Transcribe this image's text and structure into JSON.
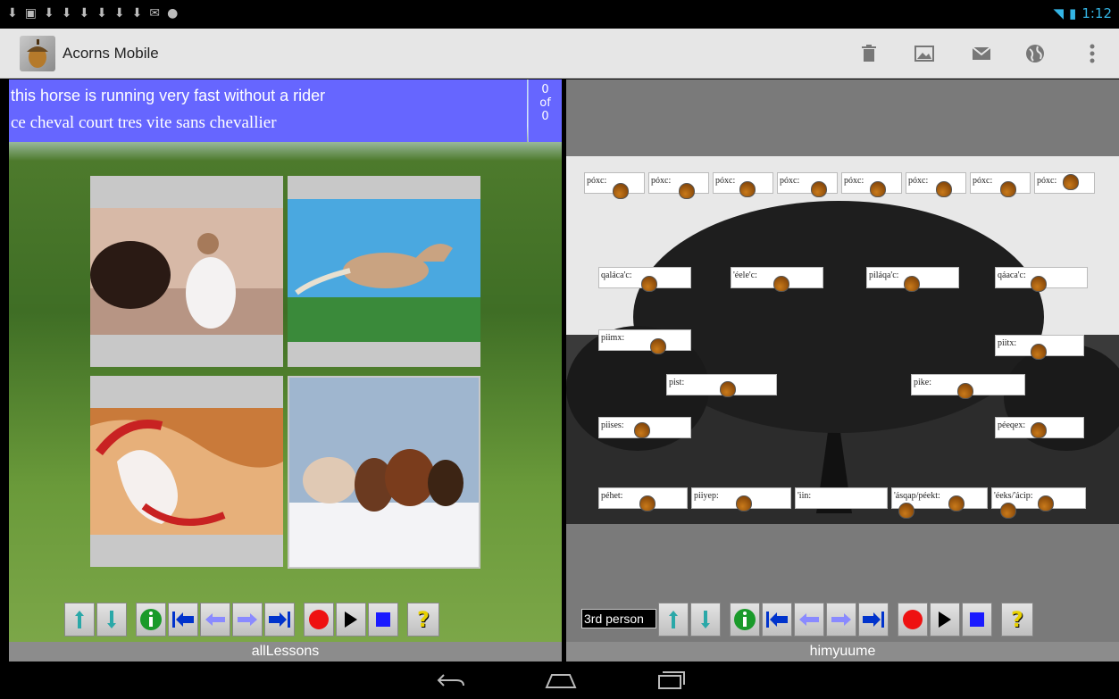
{
  "status_bar": {
    "time": "1:12",
    "notification_icons": [
      "download-icon",
      "image-icon",
      "download-icon",
      "download-icon",
      "download-icon",
      "download-icon",
      "download-icon",
      "download-icon",
      "gmail-icon",
      "android-icon"
    ],
    "wifi_icon": "wifi-icon",
    "battery_icon": "battery-icon"
  },
  "action_bar": {
    "title": "Acorns Mobile",
    "actions": [
      "trash-icon",
      "image-icon",
      "mail-icon",
      "globe-icon",
      "overflow-menu-icon"
    ]
  },
  "left_pane": {
    "phrase_line1": "this horse is running very fast without a rider",
    "phrase_line2": "ce cheval court tres vite sans chevallier",
    "counter_current": "0",
    "counter_of": "of",
    "counter_total": "0",
    "images": [
      "woman-with-horse-picture",
      "running-horse-picture",
      "painted-horse-picture",
      "horse-herd-picture"
    ],
    "label": "allLessons"
  },
  "right_pane": {
    "label": "himyuume",
    "relation_field": "3rd person",
    "top_row": [
      "póxc:",
      "póxc:",
      "póxc:",
      "póxc:",
      "póxc:",
      "póxc:",
      "póxc:",
      "póxc:"
    ],
    "second_row": [
      "qaláca'c:",
      "'éele'c:",
      "piláqa'c:",
      "qáaca'c:"
    ],
    "left_column": [
      "piimx:",
      "pist:",
      "piises:"
    ],
    "right_column": [
      "piitx:",
      "pike:",
      "péeqex:"
    ],
    "bottom_row": [
      "péhet:",
      "piiyep:",
      "'iin:",
      "'ásqap/péekt:",
      "'éeks/'ácip:"
    ]
  },
  "toolbar_buttons": [
    "up-level-icon",
    "down-level-icon",
    "info-icon",
    "first-icon",
    "previous-icon",
    "next-icon",
    "last-icon",
    "record-icon",
    "play-icon",
    "stop-icon",
    "help-icon"
  ],
  "nav_bar": [
    "back-icon",
    "home-icon",
    "recents-icon"
  ]
}
